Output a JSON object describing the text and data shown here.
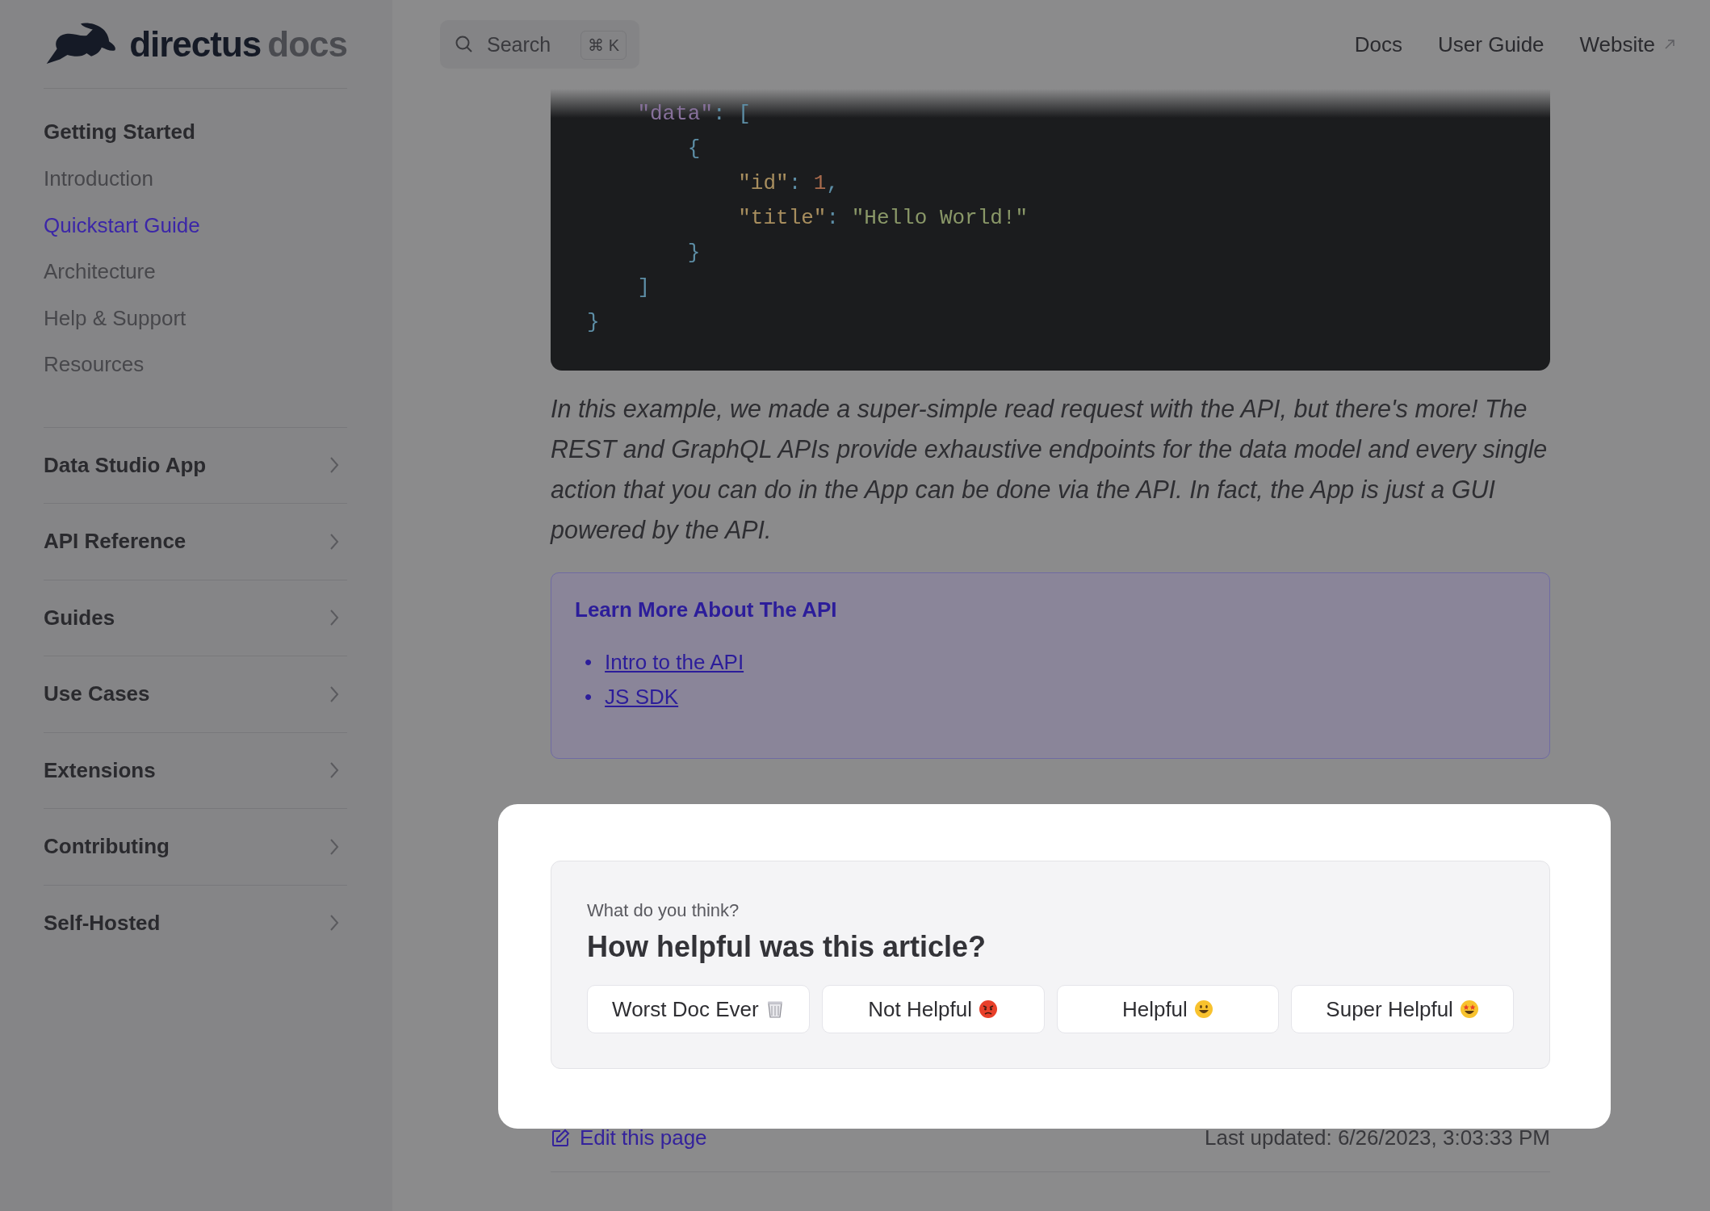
{
  "header": {
    "logo": {
      "brand": "directus",
      "suffix": "docs"
    },
    "search": {
      "placeholder": "Search",
      "shortcut": "⌘ K"
    },
    "nav": [
      {
        "label": "Docs",
        "external": false
      },
      {
        "label": "User Guide",
        "external": false
      },
      {
        "label": "Website",
        "external": true
      }
    ]
  },
  "sidebar": {
    "section": {
      "title": "Getting Started",
      "items": [
        {
          "label": "Introduction",
          "selected": false
        },
        {
          "label": "Quickstart Guide",
          "selected": true
        },
        {
          "label": "Architecture",
          "selected": false
        },
        {
          "label": "Help & Support",
          "selected": false
        },
        {
          "label": "Resources",
          "selected": false
        }
      ]
    },
    "groups": [
      {
        "label": "Data Studio App",
        "expanded": false
      },
      {
        "label": "API Reference",
        "expanded": false
      },
      {
        "label": "Guides",
        "expanded": false
      },
      {
        "label": "Use Cases",
        "expanded": false
      },
      {
        "label": "Extensions",
        "expanded": false
      },
      {
        "label": "Contributing",
        "expanded": false
      },
      {
        "label": "Self-Hosted",
        "expanded": false
      }
    ]
  },
  "code": {
    "lines": [
      [
        {
          "text": "    \"data\"",
          "kind": "key"
        },
        {
          "text": ": [",
          "kind": "punct"
        }
      ],
      [
        {
          "text": "        {",
          "kind": "punct"
        }
      ],
      [
        {
          "text": "            \"id\"",
          "kind": "prop"
        },
        {
          "text": ": ",
          "kind": "punct"
        },
        {
          "text": "1",
          "kind": "number"
        },
        {
          "text": ",",
          "kind": "punct"
        }
      ],
      [
        {
          "text": "            \"title\"",
          "kind": "prop"
        },
        {
          "text": ": ",
          "kind": "punct"
        },
        {
          "text": "\"Hello World!\"",
          "kind": "string"
        }
      ],
      [
        {
          "text": "        }",
          "kind": "punct"
        }
      ],
      [
        {
          "text": "    ]",
          "kind": "punct"
        }
      ],
      [
        {
          "text": "}",
          "kind": "punct"
        }
      ]
    ]
  },
  "paragraph": "In this example, we made a super-simple read request with the API, but there's more! The REST and GraphQL APIs provide exhaustive endpoints for the data model and every single action that you can do in the App can be done via the API. In fact, the App is just a GUI powered by the API.",
  "callout": {
    "title": "Learn More About The API",
    "links": [
      {
        "marker": "•",
        "label": "Intro to the API"
      },
      {
        "marker": "•",
        "label": "JS SDK"
      }
    ]
  },
  "feedback": {
    "eyebrow": "What do you think?",
    "question": "How helpful was this article?",
    "options": [
      {
        "label": "Worst Doc Ever",
        "kind": "trash"
      },
      {
        "label": "Not Helpful",
        "kind": "angry"
      },
      {
        "label": "Helpful",
        "kind": "smile"
      },
      {
        "label": "Super Helpful",
        "kind": "starstruck"
      }
    ]
  },
  "footer": {
    "edit_link": "Edit this page",
    "last_updated": "Last updated: 6/26/2023, 3:03:33 PM"
  }
}
